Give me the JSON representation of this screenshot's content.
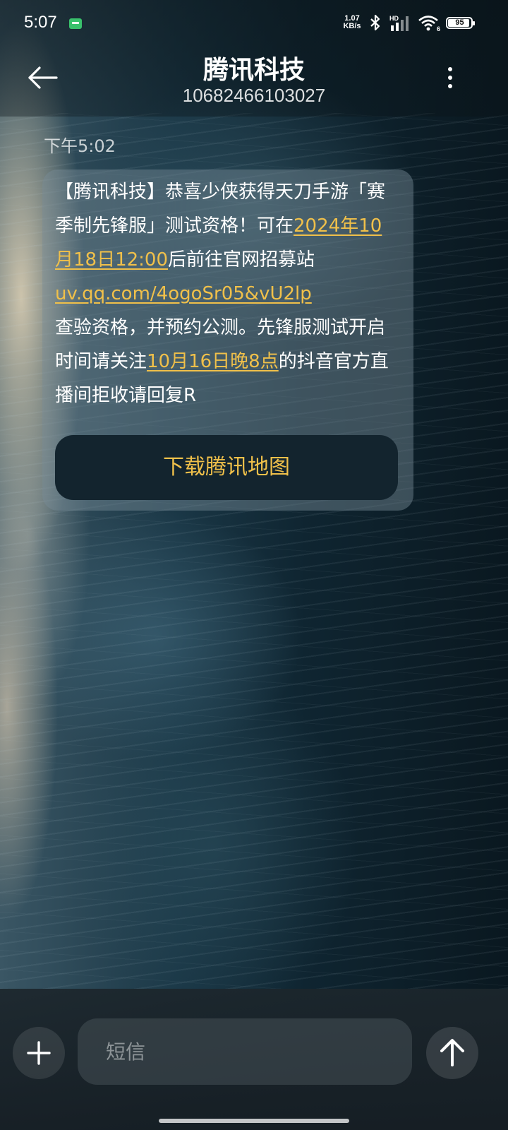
{
  "status_bar": {
    "time": "5:07",
    "net_speed_value": "1.07",
    "net_speed_unit": "KB/s",
    "signal_label": "HD",
    "wifi_label": "6",
    "battery": "95",
    "icons": [
      "message-notification-icon",
      "bluetooth-icon",
      "signal-icon",
      "wifi-icon",
      "battery-icon"
    ]
  },
  "header": {
    "title": "腾讯科技",
    "number": "10682466103027",
    "icons": [
      "back-arrow-icon",
      "more-vert-icon"
    ]
  },
  "message": {
    "time": "下午5:02",
    "part1": "【腾讯科技】恭喜少侠获得天刀手游「赛季制先锋服」测试资格！可在",
    "date_link": "2024年10月18日12:00",
    "part2": "后前往官网招募站 ",
    "url_link": "uv.qq.com/4ogoSr05&vU2lp",
    "part3": "查验资格，并预约公测。先锋服测试开启时间请关注",
    "time_link": "10月16日晚8点",
    "part4": "的抖音官方直播间拒收请回复R",
    "action_label": "下载腾讯地图",
    "link_color": "#f0c04a"
  },
  "composer": {
    "placeholder": "短信",
    "icons": [
      "plus-icon",
      "send-arrow-icon"
    ]
  }
}
